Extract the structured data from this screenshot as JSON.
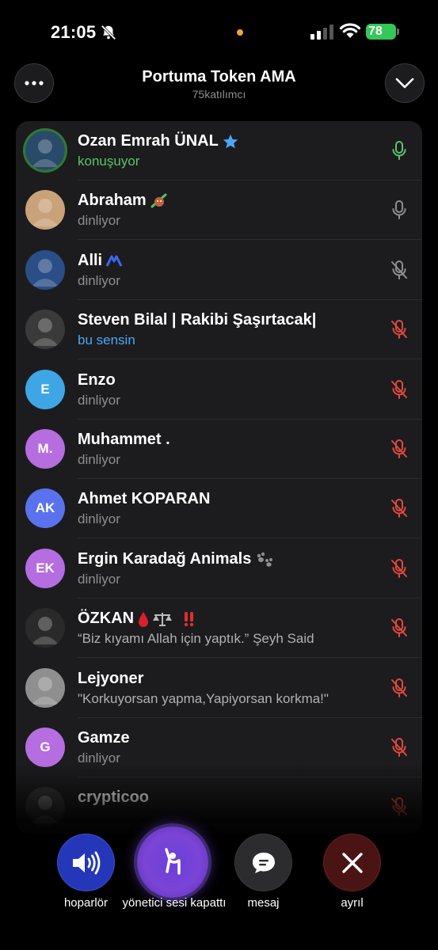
{
  "status_bar": {
    "time": "21:05",
    "battery": "78"
  },
  "header": {
    "title": "Portuma Token AMA",
    "subtitle": "75katılımcı"
  },
  "participants": [
    {
      "name": "Ozan Emrah ÜNAL",
      "status": "konuşuyor",
      "status_style": "green",
      "mic": "active",
      "avatar": "photo",
      "avatar_color": "#2a4a6a",
      "badge": "star"
    },
    {
      "name": "Abraham",
      "status": "dinliyor",
      "status_style": "gray",
      "mic": "idle",
      "avatar": "photo",
      "avatar_color": "#c9a27a",
      "badge": "emoji-bull"
    },
    {
      "name": "Alli",
      "status": "dinliyor",
      "status_style": "gray",
      "mic": "muted-gray",
      "avatar": "photo",
      "avatar_color": "#2b4e86",
      "badge": "emoji-blue"
    },
    {
      "name": "Steven Bilal | Rakibi Şaşırtacak|",
      "status": "bu sensin",
      "status_style": "blue",
      "mic": "muted-red",
      "avatar": "photo",
      "avatar_color": "#3a3a3a"
    },
    {
      "name": "Enzo",
      "status": "dinliyor",
      "status_style": "gray",
      "mic": "muted-red",
      "avatar": "initials",
      "initials": "E",
      "avatar_color": "#3fa6e6"
    },
    {
      "name": "Muhammet .",
      "status": "dinliyor",
      "status_style": "gray",
      "mic": "muted-red",
      "avatar": "initials",
      "initials": "M.",
      "avatar_color": "#b56de0"
    },
    {
      "name": "Ahmet KOPARAN",
      "status": "dinliyor",
      "status_style": "gray",
      "mic": "muted-red",
      "avatar": "initials",
      "initials": "AK",
      "avatar_color": "#5b72ee"
    },
    {
      "name": "Ergin Karadağ Animals",
      "status": "dinliyor",
      "status_style": "gray",
      "mic": "muted-red",
      "avatar": "initials",
      "initials": "EK",
      "avatar_color": "#b56de0",
      "badge": "emoji-paws"
    },
    {
      "name": "ÖZKAN",
      "status": "“Biz kıyamı Allah için yaptık.” Şeyh Said",
      "status_style": "light",
      "mic": "muted-red",
      "avatar": "photo",
      "avatar_color": "#2a2a2a",
      "badge": "emoji-drop-scale"
    },
    {
      "name": "Lejyoner",
      "status": "\"Korkuyorsan yapma,Yapiyorsan korkma!\"",
      "status_style": "light",
      "mic": "muted-red",
      "avatar": "photo",
      "avatar_color": "#8f8f8f"
    },
    {
      "name": "Gamze",
      "status": "dinliyor",
      "status_style": "gray",
      "mic": "muted-red",
      "avatar": "initials",
      "initials": "G",
      "avatar_color": "#b56de0"
    },
    {
      "name": "crypticoo",
      "status": "",
      "status_style": "gray",
      "mic": "muted-red",
      "avatar": "photo",
      "avatar_color": "#333"
    }
  ],
  "controls": {
    "speaker_label": "hoparlör",
    "admin_label": "yönetici sesi kapattı",
    "message_label": "mesaj",
    "leave_label": "ayrıl"
  },
  "colors": {
    "accent_green": "#35c759",
    "muted_red": "#e0493d",
    "blue": "#4ba7f5",
    "panel": "#1c1c1e"
  }
}
